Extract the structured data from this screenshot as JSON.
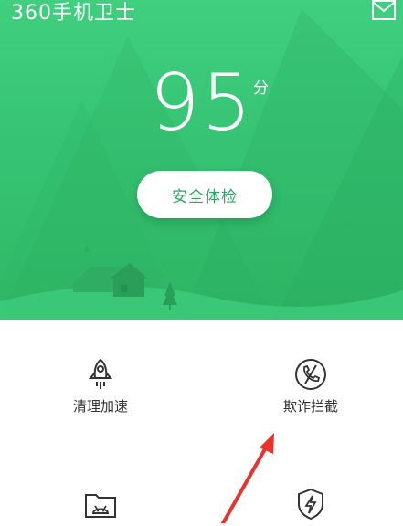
{
  "header": {
    "brand": "360手机卫士",
    "mail_icon": "mail-icon"
  },
  "score": {
    "value": "95",
    "unit": "分"
  },
  "check_button": {
    "label": "安全体检"
  },
  "tiles": [
    {
      "label": "清理加速",
      "icon": "rocket-icon"
    },
    {
      "label": "欺诈拦截",
      "icon": "blocked-call-icon"
    },
    {
      "label": "",
      "icon": "android-folder-icon"
    },
    {
      "label": "",
      "icon": "shield-bolt-icon"
    }
  ],
  "colors": {
    "hero": "#36c474",
    "accent": "#2aa862",
    "arrow": "#e8322b"
  }
}
